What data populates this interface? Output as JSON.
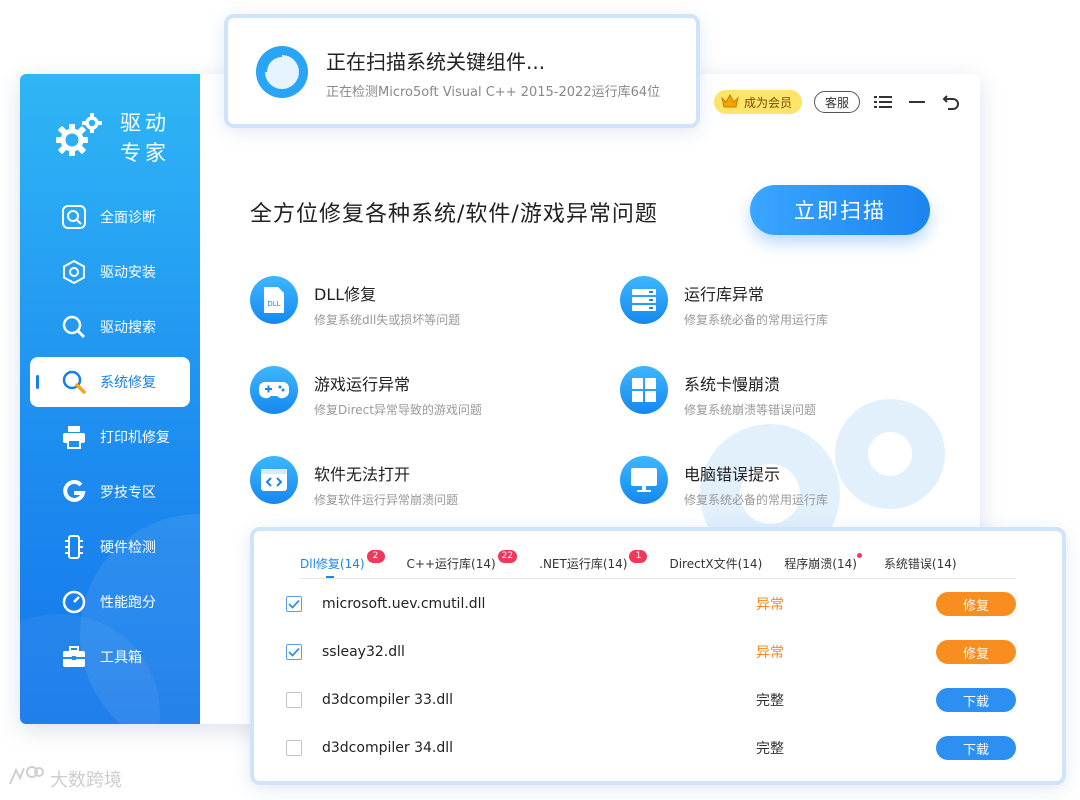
{
  "app": {
    "name_line1": "驱动",
    "name_line2": "专家"
  },
  "sidebar": {
    "items": [
      {
        "label": "全面诊断",
        "icon": "diagnose-icon"
      },
      {
        "label": "驱动安装",
        "icon": "install-icon"
      },
      {
        "label": "驱动搜索",
        "icon": "search-icon"
      },
      {
        "label": "系统修复",
        "icon": "wrench-icon",
        "active": true
      },
      {
        "label": "打印机修复",
        "icon": "printer-icon"
      },
      {
        "label": "罗技专区",
        "icon": "logitech-icon"
      },
      {
        "label": "硬件检测",
        "icon": "hardware-icon"
      },
      {
        "label": "性能跑分",
        "icon": "gauge-icon"
      },
      {
        "label": "工具箱",
        "icon": "toolbox-icon"
      }
    ]
  },
  "topbar": {
    "vip_label": "成为会员",
    "service_label": "客服",
    "icons": [
      "menu-icon",
      "minimize-icon",
      "back-icon"
    ]
  },
  "main": {
    "headline": "全方位修复各种系统/软件/游戏异常问题",
    "scan_button": "立即扫描",
    "features": [
      {
        "title": "DLL修复",
        "desc": "修复系统dll失或损坏等问题",
        "icon": "dll-icon"
      },
      {
        "title": "运行库异常",
        "desc": "修复系统必备的常用运行库",
        "icon": "server-icon"
      },
      {
        "title": "游戏运行异常",
        "desc": "修复Direct异常导致的游戏问题",
        "icon": "gamepad-icon"
      },
      {
        "title": "系统卡慢崩溃",
        "desc": "修复系统崩溃等错误问题",
        "icon": "windows-icon"
      },
      {
        "title": "软件无法打开",
        "desc": "修复软件运行异常崩溃问题",
        "icon": "code-window-icon"
      },
      {
        "title": "电脑错误提示",
        "desc": "修复系统必备的常用运行库",
        "icon": "monitor-icon"
      }
    ]
  },
  "scanning": {
    "title": "正在扫描系统关键组件...",
    "subtitle": "正在检测Micro5oft Visual C++ 2015-2022运行库64位"
  },
  "panel": {
    "tabs": [
      {
        "label": "Dll修复(14)",
        "badge": "2",
        "active": true
      },
      {
        "label": "C++运行库(14)",
        "badge": "22"
      },
      {
        "label": ".NET运行库(14)",
        "badge": "1"
      },
      {
        "label": "DirectX文件(14)",
        "badge": ""
      },
      {
        "label": "程序崩溃(14)",
        "dot": true
      },
      {
        "label": "系统错误(14)",
        "badge": ""
      }
    ],
    "rows": [
      {
        "file": "microsoft.uev.cmutil.dll",
        "status": "异常",
        "action": "修复",
        "checked": true,
        "kind": "bad"
      },
      {
        "file": "ssleay32.dll",
        "status": "异常",
        "action": "修复",
        "checked": true,
        "kind": "bad"
      },
      {
        "file": "d3dcompiler 33.dll",
        "status": "完整",
        "action": "下载",
        "checked": false,
        "kind": "ok"
      },
      {
        "file": "d3dcompiler 34.dll",
        "status": "完整",
        "action": "下载",
        "checked": false,
        "kind": "ok"
      }
    ]
  },
  "watermark": "大数跨境",
  "colors": {
    "brand_blue": "#1b84f0",
    "sidebar_top": "#2fb6f5",
    "warning_orange": "#f98e20",
    "vip_yellow": "#ffe46b",
    "badge_red": "#f0385a"
  }
}
